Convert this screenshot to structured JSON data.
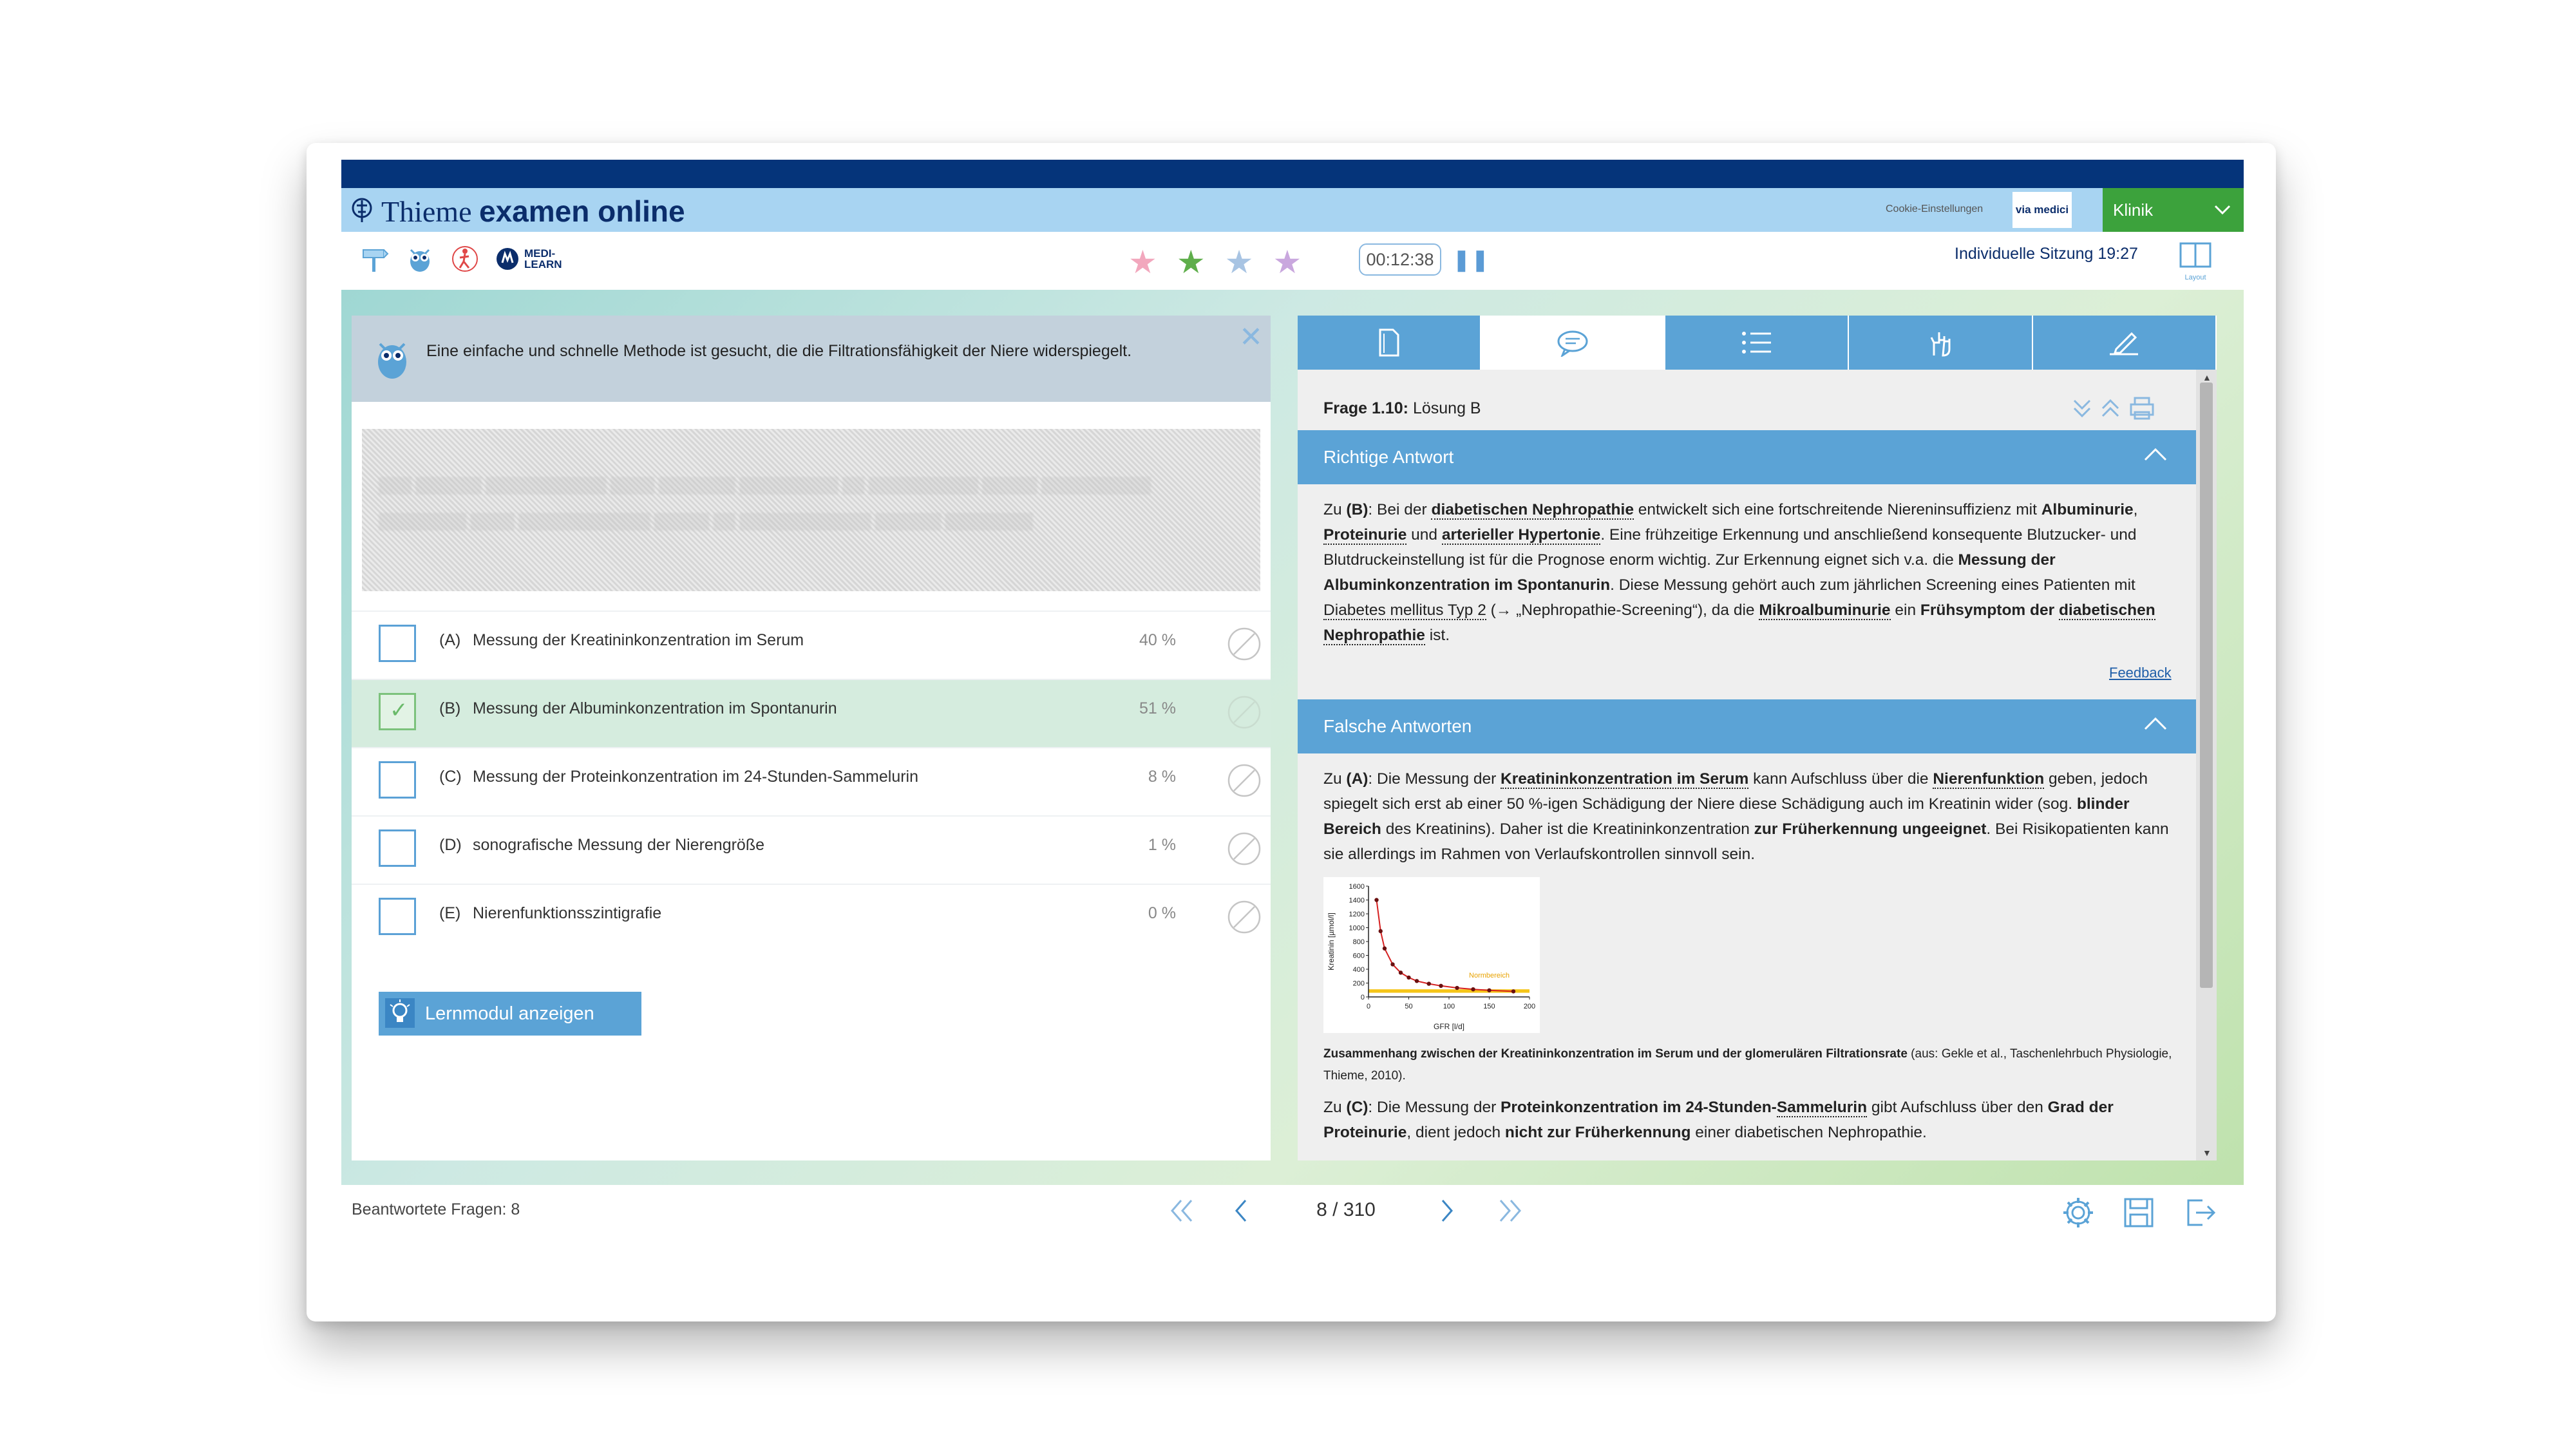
{
  "app": {
    "brand_thieme": "Thieme",
    "brand_product": "examen online",
    "cookie_link": "Cookie-Einstellungen",
    "via_medici": "via medici",
    "area": "Klinik",
    "session": "Individuelle Sitzung 19:27",
    "layout_label": "Layout",
    "timer": "00:12:38",
    "medilearn_top": "MEDI-",
    "medilearn_bottom": "LEARN"
  },
  "toolbar": {
    "icons": [
      "signpost-icon",
      "owl-icon",
      "figure-icon",
      "medi-learn-logo"
    ],
    "stars": [
      {
        "icon": "star-icon",
        "color": "#f2a7bd"
      },
      {
        "icon": "star-icon",
        "color": "#5fae4b"
      },
      {
        "icon": "star-icon",
        "color": "#a8c4e3"
      },
      {
        "icon": "star-icon",
        "color": "#c9a7de"
      }
    ]
  },
  "question": {
    "hint": "Eine einfache und schnelle Methode ist gesucht, die die Filtrationsfähigkeit der Niere widerspiegelt.",
    "answers": [
      {
        "letter": "(A)",
        "text": "Messung der Kreatininkonzentration im Serum",
        "percent": "40 %",
        "selected": false
      },
      {
        "letter": "(B)",
        "text": "Messung der Albuminkonzentration im Spontanurin",
        "percent": "51 %",
        "selected": true
      },
      {
        "letter": "(C)",
        "text": "Messung der Proteinkonzentration im 24-Stunden-Sammelurin",
        "percent": "8 %",
        "selected": false
      },
      {
        "letter": "(D)",
        "text": "sonografische Messung der Nierengröße",
        "percent": "1 %",
        "selected": false
      },
      {
        "letter": "(E)",
        "text": "Nierenfunktionsszintigrafie",
        "percent": "0 %",
        "selected": false
      }
    ],
    "lernmodul_button": "Lernmodul anzeigen"
  },
  "solution": {
    "tabs": [
      "document-icon",
      "comment-icon",
      "list-icon",
      "hand-icon",
      "edit-icon"
    ],
    "active_tab": 1,
    "frage_label": "Frage 1.10:",
    "frage_value": "Lösung B",
    "correct_header": "Richtige Antwort",
    "wrong_header": "Falsche Antworten",
    "feedback": "Feedback",
    "correct_parts": {
      "p1": "Zu ",
      "p2": "(B)",
      "p3": ": Bei der ",
      "p4": "diabetischen Nephropathie",
      "p5": " entwickelt sich eine fortschreitende Niereninsuffizienz mit ",
      "p6": "Albuminurie",
      "p7": ", ",
      "p8": "Proteinurie",
      "p9": " und ",
      "p10": "arterieller Hypertonie",
      "p11": ". Eine frühzeitige Erkennung und anschließend konsequente Blutzucker- und Blutdruckeinstellung ist für die Prognose enorm wichtig. Zur Erkennung eignet sich v.a. die ",
      "p12": "Messung der Albuminkonzentration im Spontanurin",
      "p13": ". Diese Messung gehört auch zum jährlichen Screening eines Patienten mit ",
      "p14": "Diabetes mellitus Typ 2",
      "p15": " (→ „Nephropathie-Screening“), da die ",
      "p16": "Mikroalbuminurie",
      "p17": " ein ",
      "p18": "Frühsymptom der ",
      "p19": "diabetischen Nephropathie",
      "p20": " ist."
    },
    "wrong_a": {
      "p1": "Zu ",
      "p2": "(A)",
      "p3": ": Die Messung der ",
      "p4": "Kreatininkonzentration im Serum",
      "p5": " kann Aufschluss über die ",
      "p6": "Nierenfunktion",
      "p7": " geben, jedoch spiegelt sich erst ab einer 50 %-igen Schädigung der Niere diese Schädigung auch im Kreatinin wider (sog. ",
      "p8": "blinder Bereich",
      "p9": " des Kreatinins). Daher ist die Kreatininkonzentration ",
      "p10": "zur Früherkennung ungeeignet",
      "p11": ". Bei Risikopatienten kann sie allerdings im Rahmen von Verlaufskontrollen sinnvoll sein."
    },
    "caption_bold": "Zusammenhang zwischen der Kreatininkonzentration im Serum und der glomerulären Filtrationsrate",
    "caption_rest": " (aus: Gekle et al., Taschenlehrbuch Physiologie, Thieme, 2010).",
    "wrong_c": {
      "p1": "Zu ",
      "p2": "(C)",
      "p3": ": Die Messung der ",
      "p4": "Proteinkonzentration im 24-Stunden-",
      "p5": "Sammelurin",
      "p6": " gibt Aufschluss über den ",
      "p7": "Grad der Proteinurie",
      "p8": ", dient jedoch ",
      "p9": "nicht zur Früherkennung",
      "p10": " einer diabetischen Nephropathie."
    }
  },
  "chart_data": {
    "type": "line",
    "title": "",
    "xlabel": "GFR [l/d]",
    "ylabel": "Kreatinin [µmol/l]",
    "xlim": [
      0,
      200
    ],
    "ylim": [
      0,
      1600
    ],
    "x_ticks": [
      "0",
      "50",
      "100",
      "150",
      "200"
    ],
    "y_ticks": [
      "0",
      "200",
      "400",
      "600",
      "800",
      "1000",
      "1200",
      "1400",
      "1600"
    ],
    "band_label": "Normbereich",
    "band": [
      60,
      110
    ],
    "series": [
      {
        "x": [
          10,
          15,
          20,
          30,
          40,
          50,
          60,
          75,
          90,
          110,
          130,
          150,
          180
        ],
        "y": [
          1400,
          950,
          700,
          470,
          350,
          280,
          230,
          190,
          160,
          130,
          110,
          95,
          80
        ]
      }
    ]
  },
  "footer": {
    "answered": "Beantwortete Fragen: 8",
    "page": "8 / 310"
  }
}
